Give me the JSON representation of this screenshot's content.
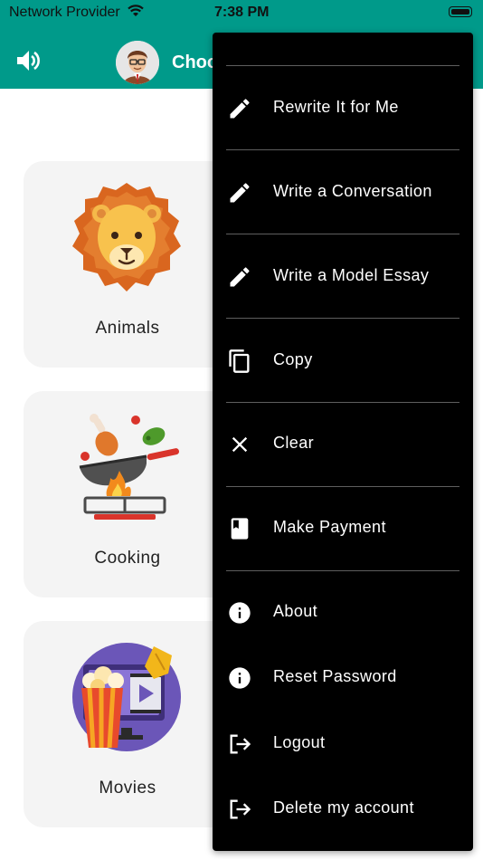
{
  "status_bar": {
    "carrier": "Network Provider",
    "time": "7:38 PM"
  },
  "header": {
    "title": "Choo"
  },
  "categories": [
    {
      "label": "Animals",
      "icon": "lion-icon"
    },
    {
      "label": "Cooking",
      "icon": "cooking-pan-icon"
    },
    {
      "label": "Movies",
      "icon": "popcorn-movie-icon"
    }
  ],
  "menu": {
    "items": [
      {
        "label": "Rewrite It for Me",
        "icon": "pencil-icon"
      },
      {
        "label": "Write a Conversation",
        "icon": "pencil-icon"
      },
      {
        "label": "Write a Model Essay",
        "icon": "pencil-icon"
      },
      {
        "label": "Copy",
        "icon": "copy-icon"
      },
      {
        "label": "Clear",
        "icon": "close-icon"
      },
      {
        "label": "Make Payment",
        "icon": "book-icon"
      },
      {
        "label": "About",
        "icon": "info-icon"
      },
      {
        "label": "Reset Password",
        "icon": "info-icon"
      },
      {
        "label": "Logout",
        "icon": "logout-icon"
      },
      {
        "label": "Delete my account",
        "icon": "logout-icon"
      }
    ]
  },
  "colors": {
    "header": "#009a8a",
    "card": "#f4f4f4",
    "menu": "#000000"
  }
}
